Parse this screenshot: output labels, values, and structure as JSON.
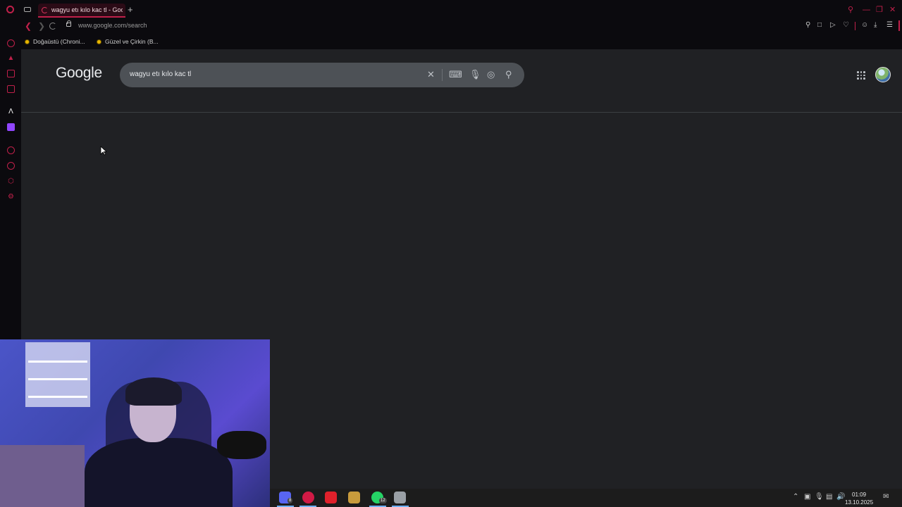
{
  "browser": {
    "tab": {
      "title": "wagyu etı kılo kac tl - Goo"
    },
    "new_tab_label": "+",
    "address": {
      "url": "www.google.com/search"
    },
    "bookmarks": [
      {
        "label": "Doğaüstü (Chroni..."
      },
      {
        "label": "Güzel ve Çirkin (B..."
      }
    ],
    "toolbar_icons": [
      "pin-icon",
      "snapshot-icon",
      "play-icon",
      "heart-icon",
      "account-icon",
      "download-icon",
      "menu-icon"
    ]
  },
  "google": {
    "logo": "Google",
    "search": {
      "query": "wagyu etı kılo kac tl"
    },
    "buttons": [
      "clear-icon",
      "keyboard-icon",
      "mic-icon",
      "lens-icon",
      "search-icon"
    ]
  },
  "taskbar": {
    "apps": [
      {
        "name": "discord",
        "color": "#5865f2",
        "badge": "8"
      },
      {
        "name": "opera-gx",
        "color": "#d11a45",
        "badge": ""
      },
      {
        "name": "app-red",
        "color": "#e0212b",
        "badge": ""
      },
      {
        "name": "league-of-legends",
        "color": "#c89b3c",
        "badge": ""
      },
      {
        "name": "whatsapp",
        "color": "#25d366",
        "badge": "12"
      },
      {
        "name": "app-shield",
        "color": "#9aa0a6",
        "badge": ""
      }
    ],
    "clock": {
      "time": "01:09",
      "date": "13.10.2025"
    }
  },
  "colors": {
    "accent": "#c0204a",
    "page_bg": "#202124",
    "search_bg": "#4d5156"
  }
}
